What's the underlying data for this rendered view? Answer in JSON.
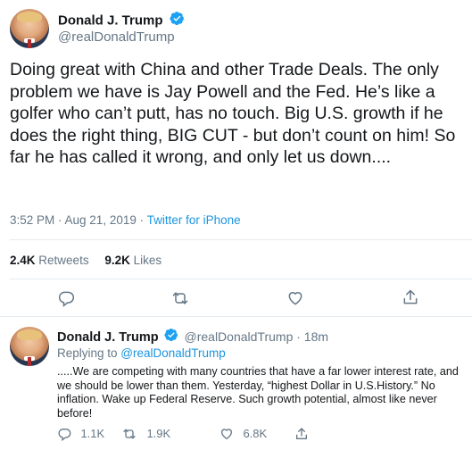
{
  "main_tweet": {
    "author_name": "Donald J. Trump",
    "handle": "@realDonaldTrump",
    "text": "Doing great with China and other Trade Deals. The only problem we have is Jay Powell and the Fed. He’s like a golfer who can’t putt, has no touch. Big U.S. growth if he does the right thing, BIG CUT - but don’t count on him! So far he has called it wrong, and only let us down....",
    "time": "3:52 PM · Aug 21, 2019 · ",
    "source": "Twitter for iPhone",
    "retweets_count": "2.4K",
    "retweets_label": "Retweets",
    "likes_count": "9.2K",
    "likes_label": "Likes"
  },
  "reply_tweet": {
    "author_name": "Donald J. Trump",
    "handle_time": "@realDonaldTrump · 18m",
    "replying_prefix": "Replying to ",
    "replying_to": "@realDonaldTrump",
    "text": ".....We are competing with many countries that have a far lower interest rate, and we should be lower than them. Yesterday, “highest Dollar in U.S.History.” No inflation. Wake up Federal Reserve. Such growth potential, almost like never before!",
    "reply_count": "1.1K",
    "retweet_count": "1.9K",
    "like_count": "6.8K"
  },
  "colors": {
    "link_blue": "#1b95e0",
    "verified_blue": "#1da1f2",
    "muted_gray": "#657786",
    "divider": "#e6ecf0"
  },
  "icons": [
    "reply-icon",
    "retweet-icon",
    "like-icon",
    "share-icon",
    "verified-badge-icon"
  ]
}
